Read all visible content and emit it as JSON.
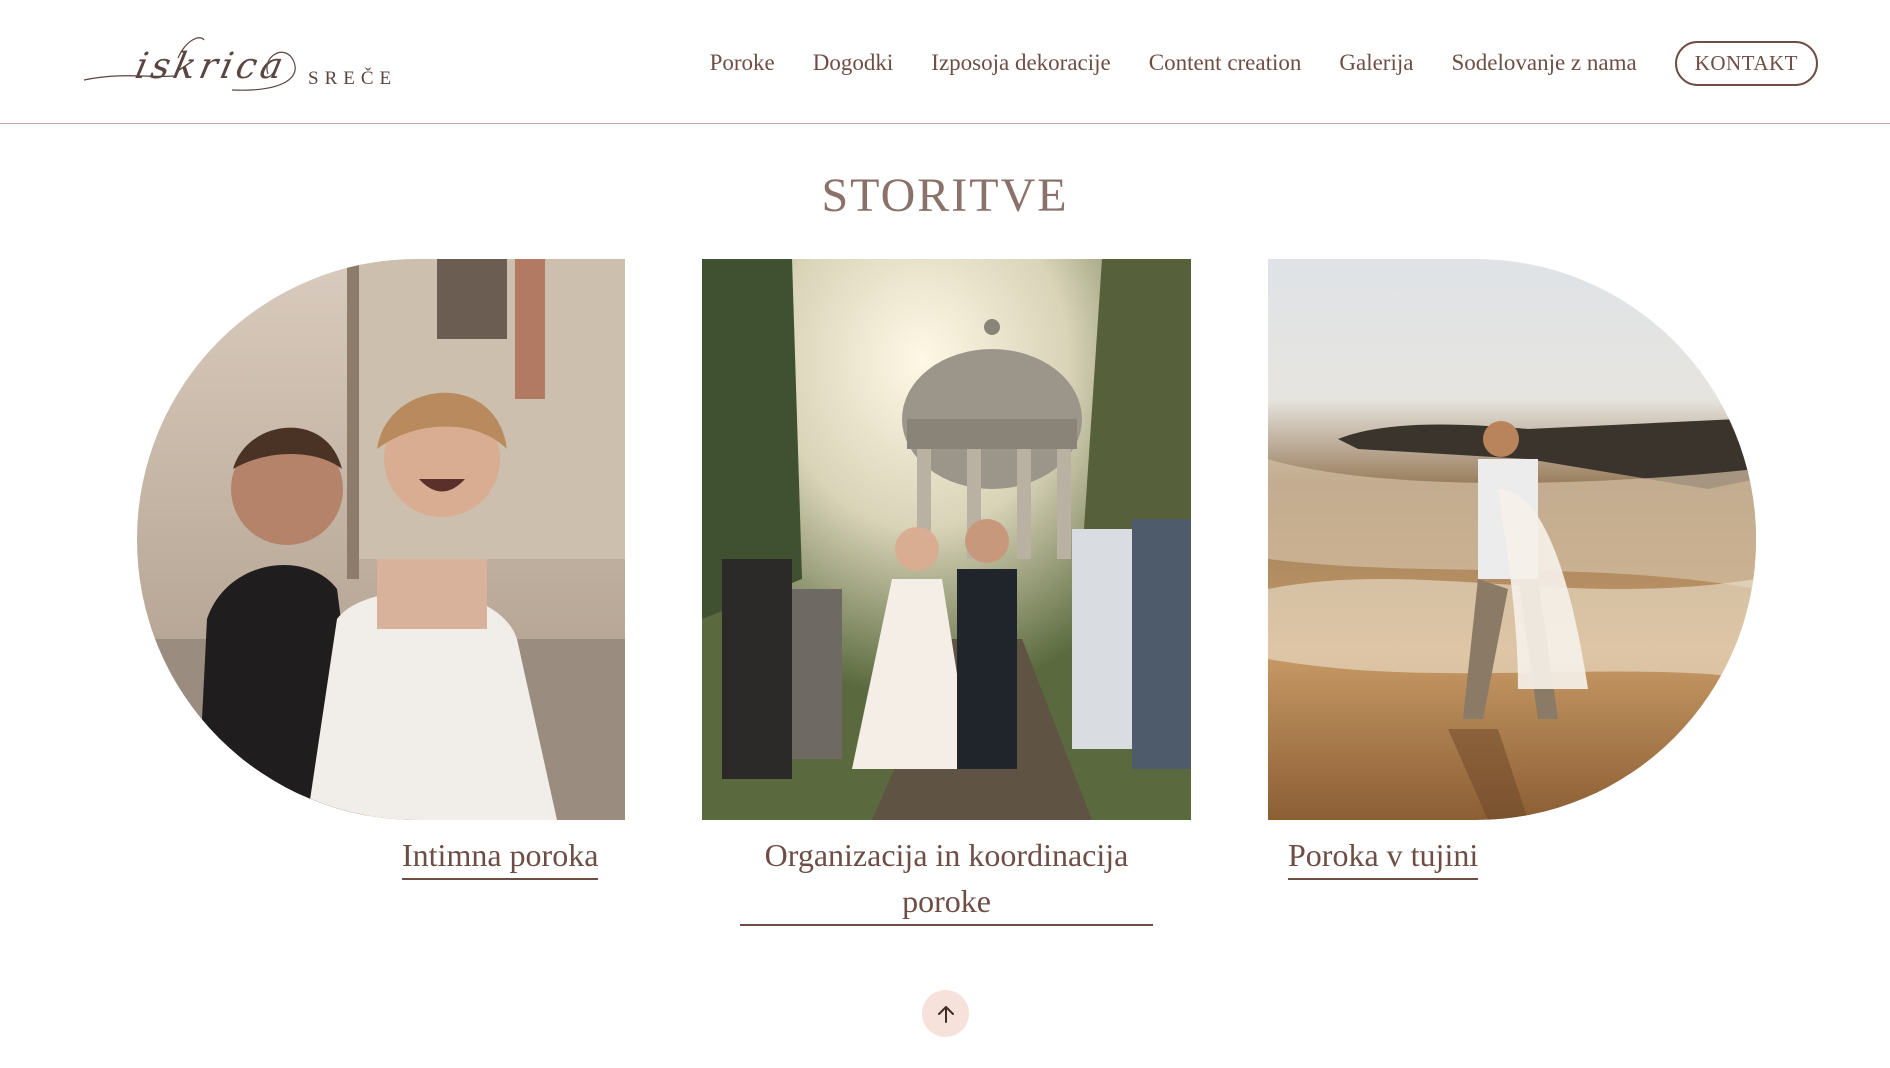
{
  "header": {
    "logo": {
      "script_text": "iskrica",
      "word_text": "SREČE"
    },
    "nav": [
      {
        "label": "Poroke"
      },
      {
        "label": "Dogodki"
      },
      {
        "label": "Izposoja dekoracije"
      },
      {
        "label": "Content creation"
      },
      {
        "label": "Galerija"
      },
      {
        "label": "Sodelovanje z nama"
      }
    ],
    "contact_label": "KONTAKT"
  },
  "services": {
    "title": "STORITVE",
    "cards": [
      {
        "title": "Intimna poroka"
      },
      {
        "title": "Organizacija in koordinacija poroke"
      },
      {
        "title": "Poroka v tujini"
      }
    ]
  },
  "colors": {
    "text": "#6e4e44",
    "title": "#8a716a",
    "divider": "#c9a79c",
    "scroll_button_bg": "#f6e2da"
  },
  "icons": {
    "scroll_top": "arrow-up-icon"
  }
}
